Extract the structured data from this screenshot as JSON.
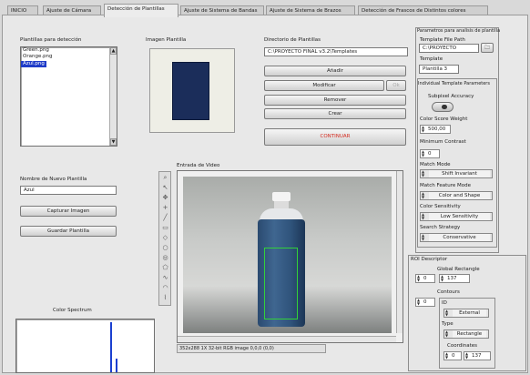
{
  "tabs": [
    {
      "label": "INICIO",
      "active": false
    },
    {
      "label": "Ajuste de Cámara",
      "active": false
    },
    {
      "label": "Detección de Plantillas",
      "active": true
    },
    {
      "label": "Ajuste de Sistema de Bandas",
      "active": false
    },
    {
      "label": "Ajuste de Sistema de Brazos",
      "active": false
    },
    {
      "label": "Detección de Frascos de Distintos colores",
      "active": false
    }
  ],
  "templates": {
    "label": "Plantillas para detección",
    "items": [
      {
        "name": "Green.png",
        "selected": false
      },
      {
        "name": "Orange.png",
        "selected": false
      },
      {
        "name": "Azul.png",
        "selected": true
      }
    ]
  },
  "preview": {
    "label": "Imagen Plantilla"
  },
  "directory": {
    "label": "Directorio de Plantillas",
    "path": "C:\\PROYECTO FINAL v3.2\\Templates"
  },
  "actions": {
    "add": "Añadir",
    "modify": "Modificar",
    "ok": "Ok",
    "remove": "Remover",
    "create": "Crear",
    "continue": "CONTINUAR"
  },
  "new_template": {
    "label": "Nombre de Nuevo Plantilla",
    "value": "Azul",
    "capture": "Capturar Imagen",
    "save": "Guardar Plantilla"
  },
  "spectrum": {
    "label": "Color Spectrum"
  },
  "video": {
    "label": "Entrada de Video",
    "status": "352x288 1X 32-bit RGB image 0,0,0   (0,0)"
  },
  "params": {
    "title": "Parametros para analisis de plantilla",
    "template_path_label": "Template File Path",
    "template_path": "C:\\PROYECTO",
    "template_label": "Template",
    "template_value": "Plantilla 3",
    "individual_label": "Individual Template Parameters",
    "subpixel_label": "Subpixel Accuracy",
    "color_weight_label": "Color Score Weight",
    "color_weight": "500,00",
    "min_contrast_label": "Minimum Contrast",
    "min_contrast": "0",
    "match_mode_label": "Match Mode",
    "match_mode": "Shift Invariant",
    "feature_mode_label": "Match Feature Mode",
    "feature_mode": "Color and Shape",
    "sensitivity_label": "Color Sensitivity",
    "sensitivity": "Low Sensitivity",
    "strategy_label": "Search Strategy",
    "strategy": "Conservative"
  },
  "roi": {
    "title": "ROI Descriptor",
    "global_rect_label": "Global Rectangle",
    "global_rect_index": "0",
    "global_rect_value": "137",
    "contours_label": "Contours",
    "contours_index": "0",
    "id_label": "ID",
    "id_value": "External",
    "type_label": "Type",
    "type_value": "Rectangle",
    "coords_label": "Coordinates",
    "coords_index": "0",
    "coords_value": "137"
  }
}
